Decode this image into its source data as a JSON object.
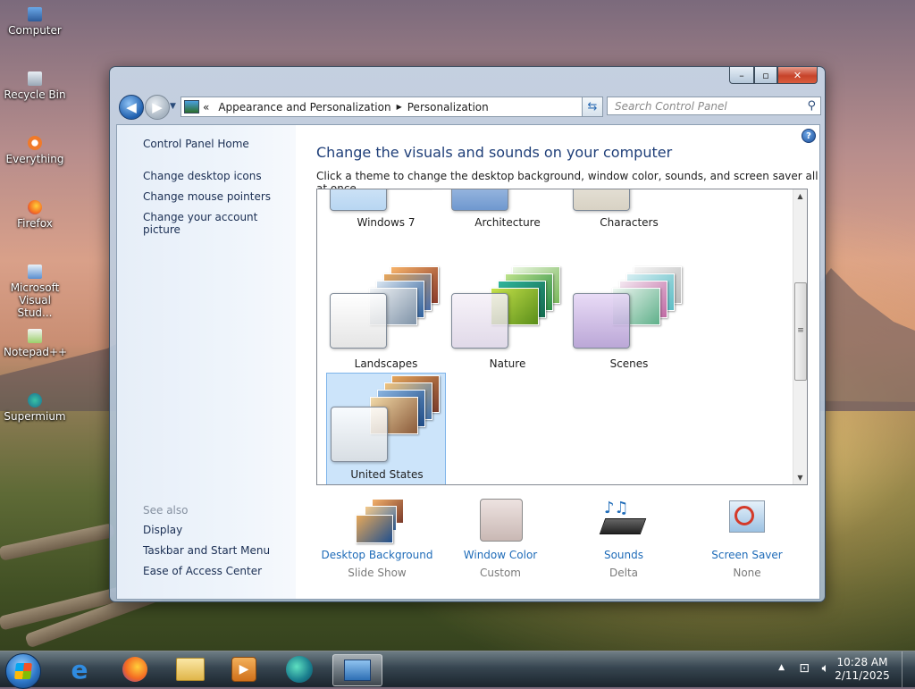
{
  "desktop": {
    "icons": [
      {
        "label": "Computer"
      },
      {
        "label": "Recycle Bin"
      },
      {
        "label": "Everything"
      },
      {
        "label": "Firefox"
      },
      {
        "label": "Microsoft Visual Stud..."
      },
      {
        "label": "Notepad++"
      },
      {
        "label": "Supermium"
      }
    ]
  },
  "window": {
    "breadcrumb": {
      "prefix": "«",
      "items": [
        "Appearance and Personalization",
        "Personalization"
      ],
      "separator": "▶"
    },
    "search": {
      "placeholder": "Search Control Panel"
    },
    "left_pane": {
      "home": "Control Panel Home",
      "links": [
        "Change desktop icons",
        "Change mouse pointers",
        "Change your account picture"
      ],
      "see_also_title": "See also",
      "see_also": [
        "Display",
        "Taskbar and Start Menu",
        "Ease of Access Center"
      ]
    },
    "heading": "Change the visuals and sounds on your computer",
    "subheading": "Click a theme to change the desktop background, window color, sounds, and screen saver all at once.",
    "themes": [
      {
        "name": "Windows 7"
      },
      {
        "name": "Architecture"
      },
      {
        "name": "Characters"
      },
      {
        "name": "Landscapes"
      },
      {
        "name": "Nature"
      },
      {
        "name": "Scenes"
      },
      {
        "name": "United States",
        "selected": true
      }
    ],
    "bottom": [
      {
        "label": "Desktop Background",
        "value": "Slide Show"
      },
      {
        "label": "Window Color",
        "value": "Custom"
      },
      {
        "label": "Sounds",
        "value": "Delta"
      },
      {
        "label": "Screen Saver",
        "value": "None"
      }
    ]
  },
  "taskbar": {
    "apps": [
      "internet-explorer-icon",
      "firefox-icon",
      "file-explorer-icon",
      "media-player-icon",
      "supermium-icon",
      "control-panel-icon"
    ],
    "clock": {
      "time": "10:28 AM",
      "date": "2/11/2025"
    }
  },
  "colors": {
    "link": "#1e6bb8",
    "heading": "#1e3e78",
    "selection": "#cce4fa"
  }
}
